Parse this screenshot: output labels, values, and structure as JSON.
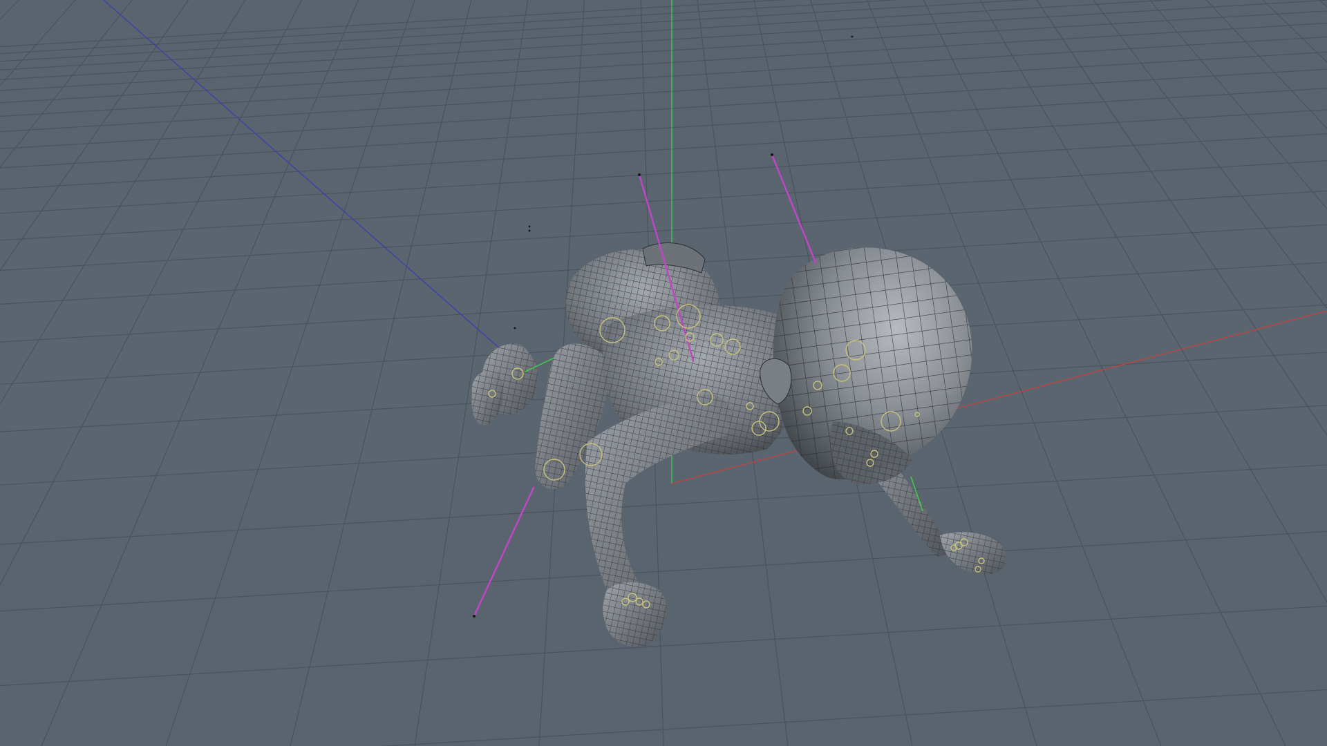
{
  "viewport": {
    "background": "#5a646e",
    "grid_color": "#4a535c",
    "axis_colors": {
      "x": "#c4423f",
      "y": "#3fcf4a",
      "z": "#3a3fb0"
    }
  },
  "scene": {
    "object": "crawling-baby-mesh",
    "render_mode": "wireframe-on-shaded",
    "mesh_color": "#8d9298",
    "wire_color": "#2e3236",
    "rig_guide_color": "#c046c8",
    "control_circle_color": "#c9c27a"
  }
}
